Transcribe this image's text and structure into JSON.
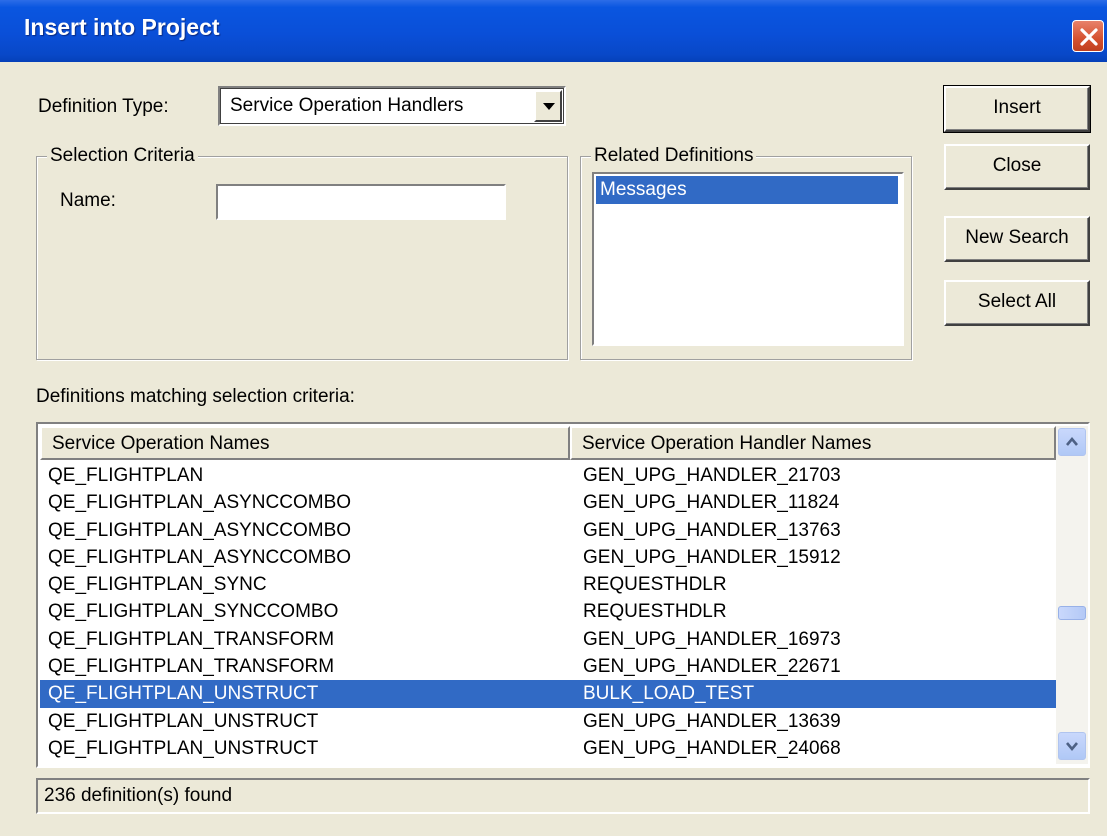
{
  "window": {
    "title": "Insert into Project"
  },
  "form": {
    "definition_type_label": "Definition Type:",
    "definition_type_value": "Service Operation Handlers",
    "selection_criteria_legend": "Selection Criteria",
    "name_label": "Name:",
    "name_value": "",
    "related_definitions_legend": "Related Definitions",
    "related_definitions_items": [
      "Messages"
    ],
    "matching_label": "Definitions matching selection criteria:"
  },
  "buttons": {
    "insert": "Insert",
    "close": "Close",
    "new_search": "New Search",
    "select_all": "Select All"
  },
  "grid": {
    "columns": [
      "Service Operation Names",
      "Service Operation Handler Names"
    ],
    "rows": [
      [
        "QE_FLIGHTPLAN",
        "GEN_UPG_HANDLER_21703"
      ],
      [
        "QE_FLIGHTPLAN_ASYNCCOMBO",
        "GEN_UPG_HANDLER_11824"
      ],
      [
        "QE_FLIGHTPLAN_ASYNCCOMBO",
        "GEN_UPG_HANDLER_13763"
      ],
      [
        "QE_FLIGHTPLAN_ASYNCCOMBO",
        "GEN_UPG_HANDLER_15912"
      ],
      [
        "QE_FLIGHTPLAN_SYNC",
        "REQUESTHDLR"
      ],
      [
        "QE_FLIGHTPLAN_SYNCCOMBO",
        "REQUESTHDLR"
      ],
      [
        "QE_FLIGHTPLAN_TRANSFORM",
        "GEN_UPG_HANDLER_16973"
      ],
      [
        "QE_FLIGHTPLAN_TRANSFORM",
        "GEN_UPG_HANDLER_22671"
      ],
      [
        "QE_FLIGHTPLAN_UNSTRUCT",
        "BULK_LOAD_TEST"
      ],
      [
        "QE_FLIGHTPLAN_UNSTRUCT",
        "GEN_UPG_HANDLER_13639"
      ],
      [
        "QE_FLIGHTPLAN_UNSTRUCT",
        "GEN_UPG_HANDLER_24068"
      ]
    ],
    "selected_row": 8
  },
  "status": {
    "text": "236 definition(s) found"
  },
  "icons": {
    "close": "close-icon",
    "dropdown": "chevron-down-icon",
    "scroll_up": "chevron-up-icon",
    "scroll_down": "chevron-down-icon"
  }
}
